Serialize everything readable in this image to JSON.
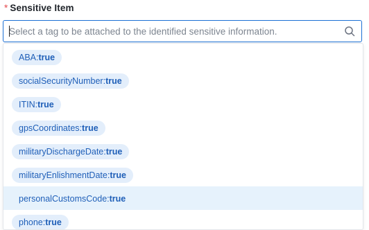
{
  "field": {
    "required_mark": "*",
    "label": "Sensitive Item"
  },
  "search": {
    "placeholder": "Select a tag to be attached to the identified sensitive information.",
    "value": ""
  },
  "options": [
    {
      "key": "ABA",
      "sep": ":",
      "value": "true",
      "highlighted": false
    },
    {
      "key": "socialSecurityNumber",
      "sep": ":",
      "value": "true",
      "highlighted": false
    },
    {
      "key": "ITIN",
      "sep": ":",
      "value": "true",
      "highlighted": false
    },
    {
      "key": "gpsCoordinates",
      "sep": ":",
      "value": "true",
      "highlighted": false
    },
    {
      "key": "militaryDischargeDate",
      "sep": ":",
      "value": "true",
      "highlighted": false
    },
    {
      "key": "militaryEnlishmentDate",
      "sep": ":",
      "value": "true",
      "highlighted": false
    },
    {
      "key": "personalCustomsCode",
      "sep": ":",
      "value": "true",
      "highlighted": true
    },
    {
      "key": "phone",
      "sep": ":",
      "value": "true",
      "highlighted": false
    }
  ],
  "colors": {
    "accent": "#1a6fd4",
    "tag_bg": "#e3eefb",
    "tag_text": "#1f5fb8",
    "highlight_bg": "#e6f2fc",
    "required": "#e5484d"
  }
}
